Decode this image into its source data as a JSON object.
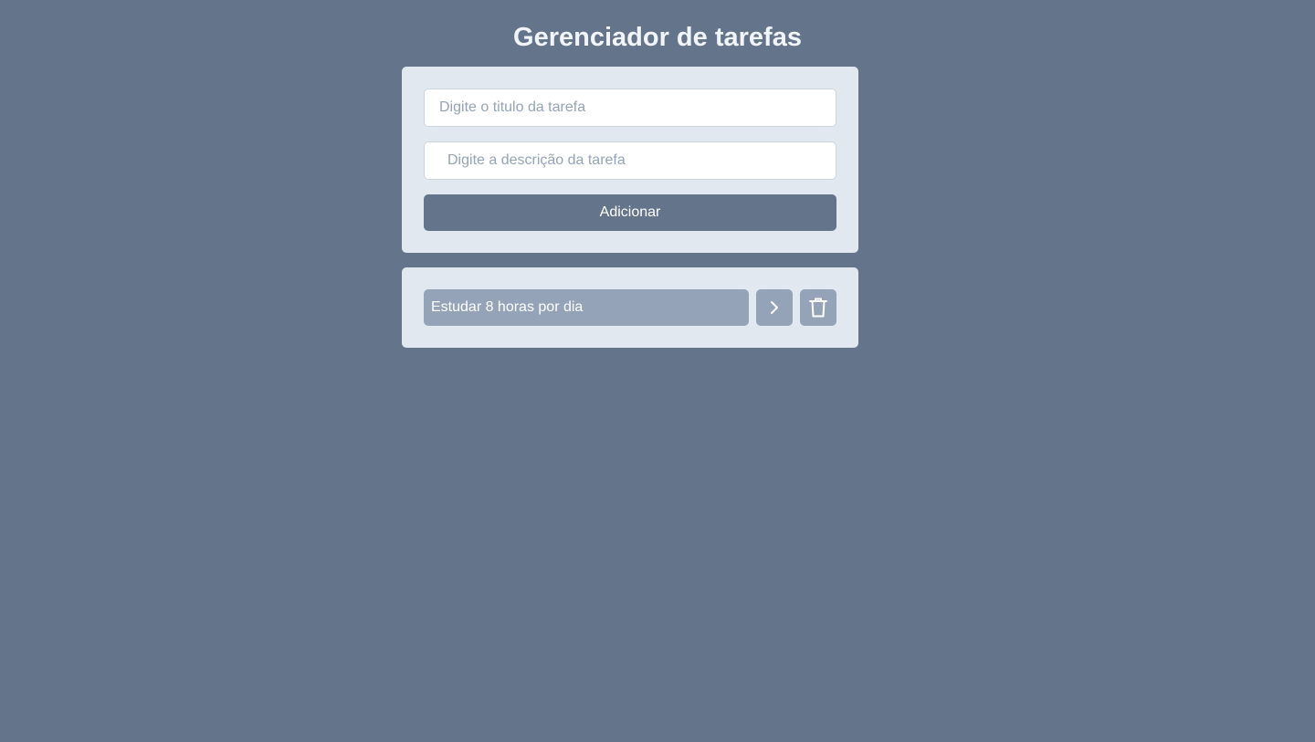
{
  "header": {
    "title": "Gerenciador de tarefas"
  },
  "form": {
    "title_placeholder": "Digite o titulo da tarefa",
    "description_placeholder": "Digite a descrição da tarefa",
    "add_label": "Adicionar"
  },
  "tasks": [
    {
      "title": "Estudar 8 horas por dia",
      "details_icon": "chevron-right-icon",
      "delete_icon": "trash-icon"
    }
  ],
  "colors": {
    "background": "#64748b",
    "card": "#e2e8f0",
    "button": "#64748b",
    "task": "#94a3b8",
    "title_text": "#f1f5f9"
  }
}
